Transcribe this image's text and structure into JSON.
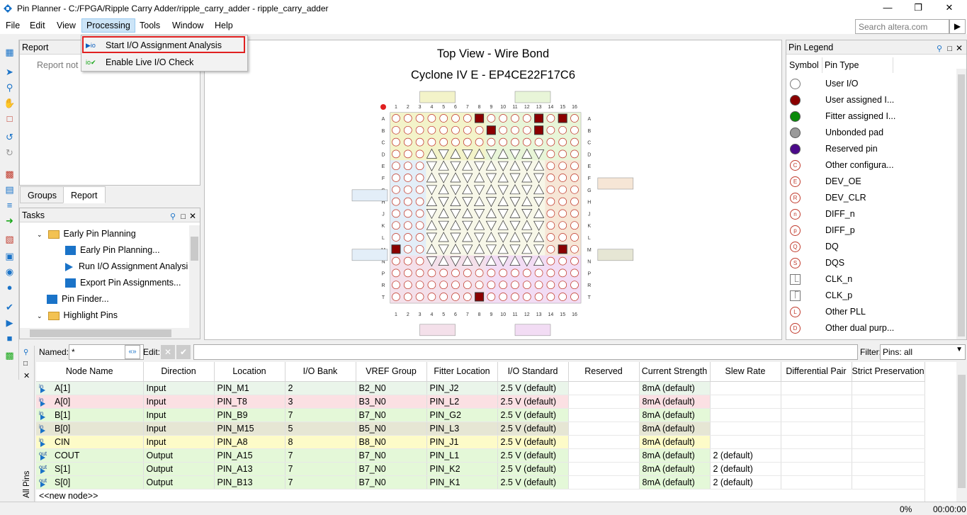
{
  "window": {
    "title": "Pin Planner - C:/FPGA/Ripple Carry Adder/ripple_carry_adder - ripple_carry_adder",
    "minimize": "—",
    "maximize": "❐",
    "close": "✕"
  },
  "menubar": {
    "items": [
      "File",
      "Edit",
      "View",
      "Processing",
      "Tools",
      "Window",
      "Help"
    ],
    "active": "Processing",
    "search_placeholder": "Search altera.com"
  },
  "processing_menu": {
    "items": [
      {
        "label": "Start I/O Assignment Analysis",
        "icon": "io-analysis-icon",
        "highlighted": true
      },
      {
        "label": "Enable Live I/O Check",
        "icon": "live-io-check-icon",
        "highlighted": false
      }
    ]
  },
  "report_panel": {
    "title": "Report",
    "body_text": "Report not a",
    "tabs": [
      "Groups",
      "Report"
    ],
    "selected_tab": "Report"
  },
  "tasks_panel": {
    "title": "Tasks",
    "items": [
      {
        "label": "Early Pin Planning",
        "type": "folder",
        "level": 1,
        "expanded": true
      },
      {
        "label": "Early Pin Planning...",
        "type": "task",
        "level": 2
      },
      {
        "label": "Run I/O Assignment Analysi",
        "type": "run",
        "level": 2
      },
      {
        "label": "Export Pin Assignments...",
        "type": "task",
        "level": 2
      },
      {
        "label": "Pin Finder...",
        "type": "task",
        "level": 1
      },
      {
        "label": "Highlight Pins",
        "type": "folder",
        "level": 1,
        "expanded": true
      }
    ]
  },
  "package_view": {
    "title": "Top View - Wire Bond",
    "subtitle": "Cyclone IV E - EP4CE22F17C6",
    "columns": [
      "1",
      "2",
      "3",
      "4",
      "5",
      "6",
      "7",
      "8",
      "9",
      "10",
      "11",
      "12",
      "13",
      "14",
      "15",
      "16"
    ],
    "rows": [
      "A",
      "B",
      "C",
      "D",
      "E",
      "F",
      "G",
      "H",
      "J",
      "K",
      "L",
      "M",
      "N",
      "P",
      "R",
      "T"
    ]
  },
  "pin_legend": {
    "title": "Pin Legend",
    "header": [
      "Symbol",
      "Pin Type"
    ],
    "items": [
      {
        "symbol": "hollow-circle",
        "color": "#ffffff",
        "label": "User I/O"
      },
      {
        "symbol": "filled-circle",
        "color": "#8b0000",
        "label": "User assigned I..."
      },
      {
        "symbol": "filled-circle",
        "color": "#0a8a0a",
        "label": "Fitter assigned I..."
      },
      {
        "symbol": "filled-circle",
        "color": "#9a9a9a",
        "label": "Unbonded pad"
      },
      {
        "symbol": "filled-circle",
        "color": "#4b0a8a",
        "label": "Reserved pin"
      },
      {
        "symbol": "letter-circle",
        "letter": "C",
        "label": "Other configura..."
      },
      {
        "symbol": "letter-circle",
        "letter": "E",
        "label": "DEV_OE"
      },
      {
        "symbol": "letter-circle",
        "letter": "R",
        "label": "DEV_CLR"
      },
      {
        "symbol": "letter-circle",
        "letter": "n",
        "label": "DIFF_n"
      },
      {
        "symbol": "letter-circle",
        "letter": "p",
        "label": "DIFF_p"
      },
      {
        "symbol": "letter-circle",
        "letter": "Q",
        "label": "DQ"
      },
      {
        "symbol": "letter-circle",
        "letter": "S",
        "label": "DQS"
      },
      {
        "symbol": "clock-n",
        "letter": "",
        "label": "CLK_n"
      },
      {
        "symbol": "clock-p",
        "letter": "",
        "label": "CLK_p"
      },
      {
        "symbol": "letter-circle",
        "letter": "L",
        "label": "Other PLL"
      },
      {
        "symbol": "letter-circle",
        "letter": "D",
        "label": "Other dual purp..."
      }
    ]
  },
  "filter_bar": {
    "named_label": "Named:",
    "named_value": "*",
    "edit_label": "Edit:",
    "filter_label": "Filter:",
    "filter_value": "Pins: all"
  },
  "pin_table": {
    "side_tab": "All Pins",
    "columns": [
      "Node Name",
      "Direction",
      "Location",
      "I/O Bank",
      "VREF Group",
      "Fitter Location",
      "I/O Standard",
      "Reserved",
      "Current Strength",
      "Slew Rate",
      "Differential Pair",
      "Strict Preservation"
    ],
    "rows": [
      {
        "tag": "in",
        "name": "A[1]",
        "direction": "Input",
        "location": "PIN_M1",
        "bank": "2",
        "vref": "B2_N0",
        "fitter": "PIN_J2",
        "standard": "2.5 V (default)",
        "reserved": "",
        "strength": "8mA (default)",
        "slew": "",
        "diff": "",
        "strict": "",
        "color": "#eaf5ea"
      },
      {
        "tag": "in",
        "name": "A[0]",
        "direction": "Input",
        "location": "PIN_T8",
        "bank": "3",
        "vref": "B3_N0",
        "fitter": "PIN_L2",
        "standard": "2.5 V (default)",
        "reserved": "",
        "strength": "8mA (default)",
        "slew": "",
        "diff": "",
        "strict": "",
        "color": "#fbe0e3"
      },
      {
        "tag": "in",
        "name": "B[1]",
        "direction": "Input",
        "location": "PIN_B9",
        "bank": "7",
        "vref": "B7_N0",
        "fitter": "PIN_G2",
        "standard": "2.5 V (default)",
        "reserved": "",
        "strength": "8mA (default)",
        "slew": "",
        "diff": "",
        "strict": "",
        "color": "#e4f8d8"
      },
      {
        "tag": "in",
        "name": "B[0]",
        "direction": "Input",
        "location": "PIN_M15",
        "bank": "5",
        "vref": "B5_N0",
        "fitter": "PIN_L3",
        "standard": "2.5 V (default)",
        "reserved": "",
        "strength": "8mA (default)",
        "slew": "",
        "diff": "",
        "strict": "",
        "color": "#e6e6d4"
      },
      {
        "tag": "in",
        "name": "CIN",
        "direction": "Input",
        "location": "PIN_A8",
        "bank": "8",
        "vref": "B8_N0",
        "fitter": "PIN_J1",
        "standard": "2.5 V (default)",
        "reserved": "",
        "strength": "8mA (default)",
        "slew": "",
        "diff": "",
        "strict": "",
        "color": "#fdfbc8"
      },
      {
        "tag": "out",
        "name": "COUT",
        "direction": "Output",
        "location": "PIN_A15",
        "bank": "7",
        "vref": "B7_N0",
        "fitter": "PIN_L1",
        "standard": "2.5 V (default)",
        "reserved": "",
        "strength": "8mA (default)",
        "slew": "2 (default)",
        "diff": "",
        "strict": "",
        "color": "#e4f8d8"
      },
      {
        "tag": "out",
        "name": "S[1]",
        "direction": "Output",
        "location": "PIN_A13",
        "bank": "7",
        "vref": "B7_N0",
        "fitter": "PIN_K2",
        "standard": "2.5 V (default)",
        "reserved": "",
        "strength": "8mA (default)",
        "slew": "2 (default)",
        "diff": "",
        "strict": "",
        "color": "#e4f8d8"
      },
      {
        "tag": "out",
        "name": "S[0]",
        "direction": "Output",
        "location": "PIN_B13",
        "bank": "7",
        "vref": "B7_N0",
        "fitter": "PIN_K1",
        "standard": "2.5 V (default)",
        "reserved": "",
        "strength": "8mA (default)",
        "slew": "2 (default)",
        "diff": "",
        "strict": "",
        "color": "#e4f8d8"
      }
    ],
    "new_node": "<<new node>>"
  },
  "statusbar": {
    "progress": "0%",
    "elapsed": "00:00:00"
  }
}
